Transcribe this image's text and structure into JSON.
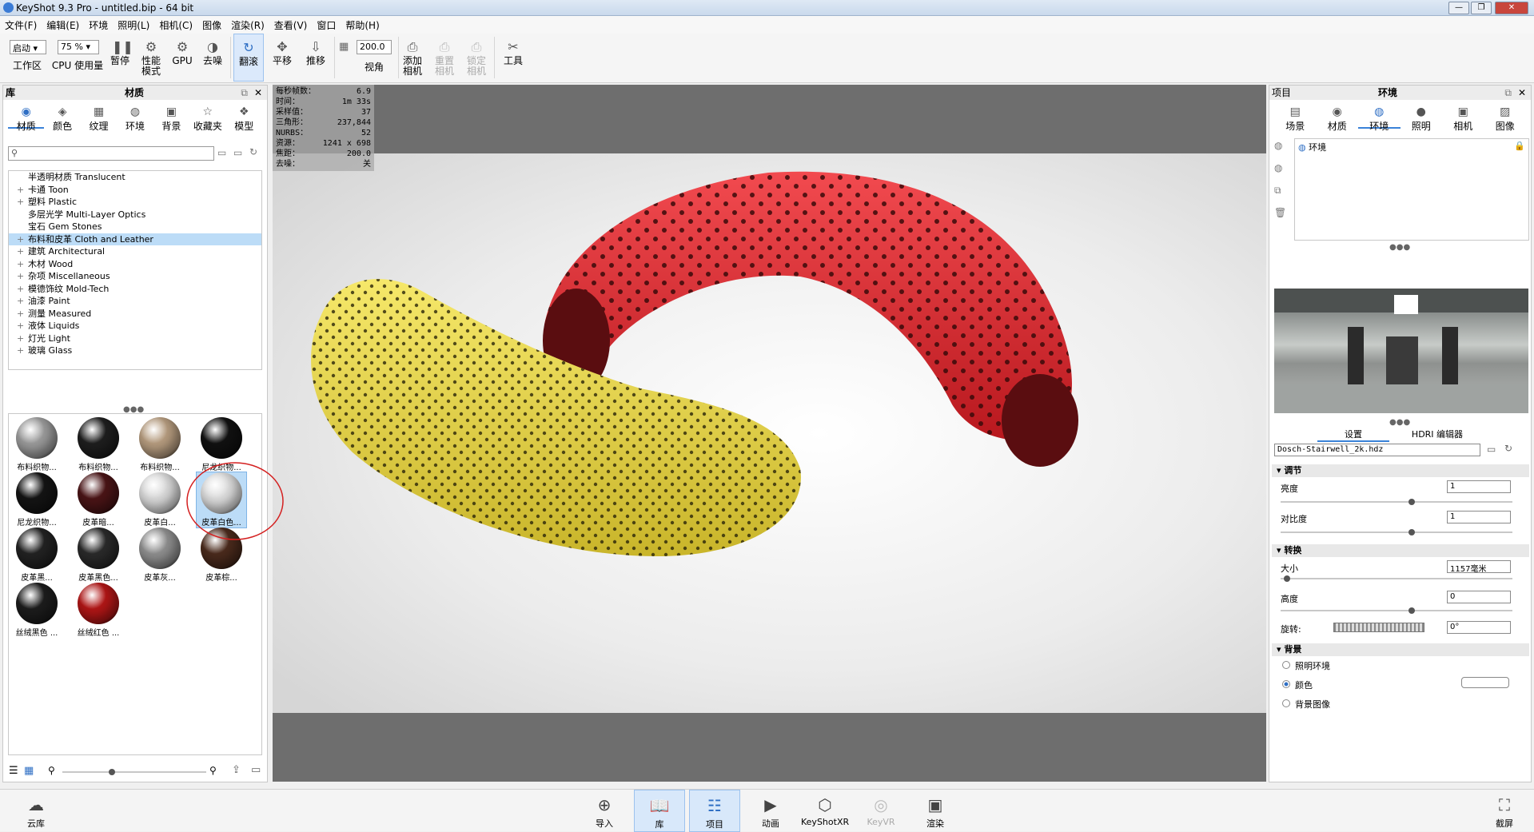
{
  "window": {
    "title": "KeyShot 9.3 Pro  - untitled.bip - 64 bit"
  },
  "menu": [
    "文件(F)",
    "编辑(E)",
    "环境",
    "照明(L)",
    "相机(C)",
    "图像",
    "渲染(R)",
    "查看(V)",
    "窗口",
    "帮助(H)"
  ],
  "toolbar": {
    "workspace_select": "启动",
    "workspace_label": "工作区",
    "cpu_select": "75 %",
    "cpu_label": "CPU 使用量",
    "pause_label": "暂停",
    "perf_label": "性能模式",
    "gpu_label": "GPU",
    "denoise_label": "去噪",
    "tumble_label": "翻滚",
    "pan_label": "平移",
    "dolly_label": "推移",
    "fov_value": "200.0",
    "fov_label": "视角",
    "add_camera_label": "添加相机",
    "reset_camera_label": "重置相机",
    "lock_camera_label": "锁定相机",
    "tools_label": "工具"
  },
  "library": {
    "title": "库",
    "subtitle": "材质",
    "tabs": [
      "材质",
      "颜色",
      "纹理",
      "环境",
      "背景",
      "收藏夹",
      "模型"
    ],
    "search_placeholder": "",
    "tree": [
      {
        "label": "半透明材质 Translucent",
        "pm": ""
      },
      {
        "label": "卡通 Toon",
        "pm": "+"
      },
      {
        "label": "塑料 Plastic",
        "pm": "+"
      },
      {
        "label": "多层光学 Multi-Layer Optics",
        "pm": ""
      },
      {
        "label": "宝石 Gem Stones",
        "pm": ""
      },
      {
        "label": "布料和皮革 Cloth and Leather",
        "pm": "+"
      },
      {
        "label": "建筑 Architectural",
        "pm": "+"
      },
      {
        "label": "木材 Wood",
        "pm": "+"
      },
      {
        "label": "杂项 Miscellaneous",
        "pm": "+"
      },
      {
        "label": "模德饰纹 Mold-Tech",
        "pm": "+"
      },
      {
        "label": "油漆 Paint",
        "pm": "+"
      },
      {
        "label": "测量 Measured",
        "pm": "+"
      },
      {
        "label": "液体 Liquids",
        "pm": "+"
      },
      {
        "label": "灯光 Light",
        "pm": "+"
      },
      {
        "label": "玻璃 Glass",
        "pm": "+"
      }
    ],
    "thumbs": [
      {
        "label": "布料织物...",
        "color": "#9a9a9a"
      },
      {
        "label": "布料织物...",
        "color": "#1e1e1e"
      },
      {
        "label": "布料织物...",
        "color": "#b59b7e"
      },
      {
        "label": "尼龙织物...",
        "color": "#111111"
      },
      {
        "label": "尼龙织物...",
        "color": "#141414"
      },
      {
        "label": "皮革暗...",
        "color": "#4a1416"
      },
      {
        "label": "皮革白...",
        "color": "#d8d8d8"
      },
      {
        "label": "皮革白色...",
        "color": "#dcdcdc"
      },
      {
        "label": "皮革黑...",
        "color": "#222222"
      },
      {
        "label": "皮革黑色...",
        "color": "#2a2a2a"
      },
      {
        "label": "皮革灰...",
        "color": "#8e8e8e"
      },
      {
        "label": "皮革棕...",
        "color": "#4a2a1c"
      },
      {
        "label": "丝绒黑色 ...",
        "color": "#1c1c1c"
      },
      {
        "label": "丝绒红色 ...",
        "color": "#b01616"
      }
    ]
  },
  "hud": [
    {
      "k": "每秒帧数：",
      "v": "6.9"
    },
    {
      "k": "时间：",
      "v": "1m 33s"
    },
    {
      "k": "采样值：",
      "v": "37"
    },
    {
      "k": "三角形：",
      "v": "237,844"
    },
    {
      "k": "NURBS：",
      "v": "52"
    },
    {
      "k": "资源：",
      "v": "1241 x 698"
    },
    {
      "k": "焦距：",
      "v": "200.0"
    },
    {
      "k": "去噪：",
      "v": "关"
    }
  ],
  "project": {
    "title": "项目",
    "subtitle": "环境",
    "tabs": [
      "场景",
      "材质",
      "环境",
      "照明",
      "相机",
      "图像"
    ],
    "env_item": "环境",
    "subtabs": [
      "设置",
      "HDRI 编辑器"
    ],
    "hdri_file": "Dosch-Stairwell_2k.hdz",
    "adjust": {
      "title": "调节",
      "brightness_label": "亮度",
      "brightness": "1",
      "contrast_label": "对比度",
      "contrast": "1"
    },
    "transform": {
      "title": "转换",
      "size_label": "大小",
      "size": "1157毫米",
      "height_label": "高度",
      "height": "0",
      "rotation_label": "旋转:",
      "rotation": "0°"
    },
    "background": {
      "title": "背景",
      "opt1": "照明环境",
      "opt2": "颜色",
      "opt3": "背景图像"
    }
  },
  "bottom": {
    "cloud": "云库",
    "import": "导入",
    "library": "库",
    "project": "项目",
    "animation": "动画",
    "keyshotxr": "KeyShotXR",
    "keyvr": "KeyVR",
    "render": "渲染",
    "screenshot": "截屏"
  },
  "colors": {
    "accent": "#3a82d8",
    "red_model": "#e8343a",
    "yellow_model": "#f2e04a"
  }
}
